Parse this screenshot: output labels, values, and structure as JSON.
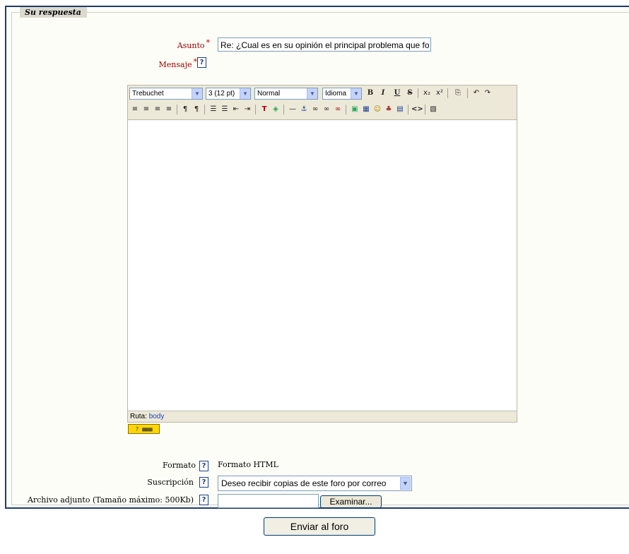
{
  "form": {
    "legend": "Su respuesta",
    "subject": {
      "label": "Asunto",
      "required_mark": "*",
      "value": "Re: ¿Cual es en su opinión el principal problema que fo"
    },
    "message": {
      "label": "Mensaje",
      "required_mark": "*"
    }
  },
  "editor": {
    "font_select": "Trebuchet",
    "size_select": "3 (12 pt)",
    "style_select": "Normal",
    "lang_select": "Idioma",
    "status_label": "Ruta:",
    "status_path": "body",
    "keyboard_badge": "?",
    "toolbar_row1": [
      "B",
      "I",
      "U",
      "S",
      "x₂",
      "x²",
      "⎘",
      "↶",
      "↷"
    ],
    "toolbar_row2": [
      "≡",
      "≡",
      "≡",
      "≡",
      "¶",
      "¶",
      "☰",
      "☰",
      "⇤",
      "⇥",
      "T",
      "◈",
      "—",
      "⚓",
      "∞",
      "∞",
      "∞",
      "▣",
      "▦",
      "☺",
      "♣",
      "▤",
      "<>",
      "▧"
    ]
  },
  "format": {
    "label": "Formato",
    "value": "Formato HTML"
  },
  "subscription": {
    "label": "Suscripción",
    "value": "Deseo recibir copias de este foro por correo"
  },
  "attachment": {
    "label": "Archivo adjunto (Tamaño máximo: 500Kb)",
    "browse_button": "Examinar..."
  },
  "submit_button": "Enviar al foro",
  "help_glyph": "?"
}
